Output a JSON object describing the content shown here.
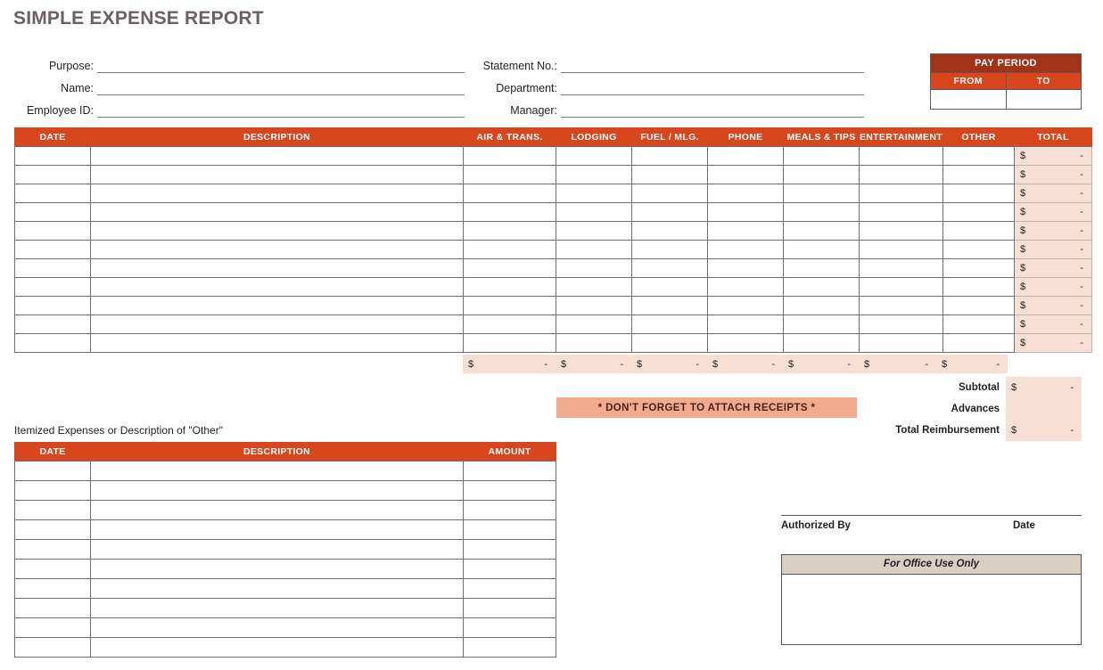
{
  "title": "SIMPLE EXPENSE REPORT",
  "colors": {
    "title_text": "#6b6160",
    "header_orange": "#d9461d",
    "pay_period_dark": "#a33216",
    "total_fill": "#f7dfd4",
    "banner_fill": "#f2ab8e",
    "office_fill": "#d8d1c3"
  },
  "header_fields": {
    "left": [
      {
        "label": "Purpose:",
        "value": ""
      },
      {
        "label": "Name:",
        "value": ""
      },
      {
        "label": "Employee ID:",
        "value": ""
      }
    ],
    "right": [
      {
        "label": "Statement No.:",
        "value": ""
      },
      {
        "label": "Department:",
        "value": ""
      },
      {
        "label": "Manager:",
        "value": ""
      }
    ]
  },
  "pay_period": {
    "title": "PAY PERIOD",
    "from_label": "FROM",
    "to_label": "TO",
    "from_value": "",
    "to_value": ""
  },
  "main_table": {
    "columns": [
      "DATE",
      "DESCRIPTION",
      "AIR & TRANS.",
      "LODGING",
      "FUEL / MLG.",
      "PHONE",
      "MEALS & TIPS",
      "ENTERTAINMENT",
      "OTHER",
      "TOTAL"
    ],
    "row_count": 11,
    "empty_currency_symbol": "$",
    "empty_currency_value": "-",
    "rows": [
      {
        "date": "",
        "description": "",
        "air": "",
        "lodging": "",
        "fuel": "",
        "phone": "",
        "meals": "",
        "entertainment": "",
        "other": "",
        "total_symbol": "$",
        "total_value": "-"
      },
      {
        "date": "",
        "description": "",
        "air": "",
        "lodging": "",
        "fuel": "",
        "phone": "",
        "meals": "",
        "entertainment": "",
        "other": "",
        "total_symbol": "$",
        "total_value": "-"
      },
      {
        "date": "",
        "description": "",
        "air": "",
        "lodging": "",
        "fuel": "",
        "phone": "",
        "meals": "",
        "entertainment": "",
        "other": "",
        "total_symbol": "$",
        "total_value": "-"
      },
      {
        "date": "",
        "description": "",
        "air": "",
        "lodging": "",
        "fuel": "",
        "phone": "",
        "meals": "",
        "entertainment": "",
        "other": "",
        "total_symbol": "$",
        "total_value": "-"
      },
      {
        "date": "",
        "description": "",
        "air": "",
        "lodging": "",
        "fuel": "",
        "phone": "",
        "meals": "",
        "entertainment": "",
        "other": "",
        "total_symbol": "$",
        "total_value": "-"
      },
      {
        "date": "",
        "description": "",
        "air": "",
        "lodging": "",
        "fuel": "",
        "phone": "",
        "meals": "",
        "entertainment": "",
        "other": "",
        "total_symbol": "$",
        "total_value": "-"
      },
      {
        "date": "",
        "description": "",
        "air": "",
        "lodging": "",
        "fuel": "",
        "phone": "",
        "meals": "",
        "entertainment": "",
        "other": "",
        "total_symbol": "$",
        "total_value": "-"
      },
      {
        "date": "",
        "description": "",
        "air": "",
        "lodging": "",
        "fuel": "",
        "phone": "",
        "meals": "",
        "entertainment": "",
        "other": "",
        "total_symbol": "$",
        "total_value": "-"
      },
      {
        "date": "",
        "description": "",
        "air": "",
        "lodging": "",
        "fuel": "",
        "phone": "",
        "meals": "",
        "entertainment": "",
        "other": "",
        "total_symbol": "$",
        "total_value": "-"
      },
      {
        "date": "",
        "description": "",
        "air": "",
        "lodging": "",
        "fuel": "",
        "phone": "",
        "meals": "",
        "entertainment": "",
        "other": "",
        "total_symbol": "$",
        "total_value": "-"
      },
      {
        "date": "",
        "description": "",
        "air": "",
        "lodging": "",
        "fuel": "",
        "phone": "",
        "meals": "",
        "entertainment": "",
        "other": "",
        "total_symbol": "$",
        "total_value": "-"
      }
    ],
    "column_totals": [
      {
        "column": "AIR & TRANS.",
        "symbol": "$",
        "value": "-"
      },
      {
        "column": "LODGING",
        "symbol": "$",
        "value": "-"
      },
      {
        "column": "FUEL / MLG.",
        "symbol": "$",
        "value": "-"
      },
      {
        "column": "PHONE",
        "symbol": "$",
        "value": "-"
      },
      {
        "column": "MEALS & TIPS",
        "symbol": "$",
        "value": "-"
      },
      {
        "column": "ENTERTAINMENT",
        "symbol": "$",
        "value": "-"
      },
      {
        "column": "OTHER",
        "symbol": "$",
        "value": "-"
      }
    ]
  },
  "receipts_notice": "* DON'T FORGET TO ATTACH RECEIPTS *",
  "summary": [
    {
      "label": "Subtotal",
      "symbol": "$",
      "value": "-"
    },
    {
      "label": "Advances",
      "symbol": "",
      "value": ""
    },
    {
      "label": "Total Reimbursement",
      "symbol": "$",
      "value": "-"
    }
  ],
  "itemized": {
    "caption": "Itemized Expenses or Description of \"Other\"",
    "columns": [
      "DATE",
      "DESCRIPTION",
      "AMOUNT"
    ],
    "row_count": 10,
    "rows": [
      {
        "date": "",
        "description": "",
        "amount": ""
      },
      {
        "date": "",
        "description": "",
        "amount": ""
      },
      {
        "date": "",
        "description": "",
        "amount": ""
      },
      {
        "date": "",
        "description": "",
        "amount": ""
      },
      {
        "date": "",
        "description": "",
        "amount": ""
      },
      {
        "date": "",
        "description": "",
        "amount": ""
      },
      {
        "date": "",
        "description": "",
        "amount": ""
      },
      {
        "date": "",
        "description": "",
        "amount": ""
      },
      {
        "date": "",
        "description": "",
        "amount": ""
      },
      {
        "date": "",
        "description": "",
        "amount": ""
      }
    ]
  },
  "authorization": {
    "authorized_by_label": "Authorized By",
    "date_label": "Date",
    "authorized_by_value": "",
    "date_value": ""
  },
  "office_use": {
    "title": "For Office Use Only",
    "notes": ""
  }
}
